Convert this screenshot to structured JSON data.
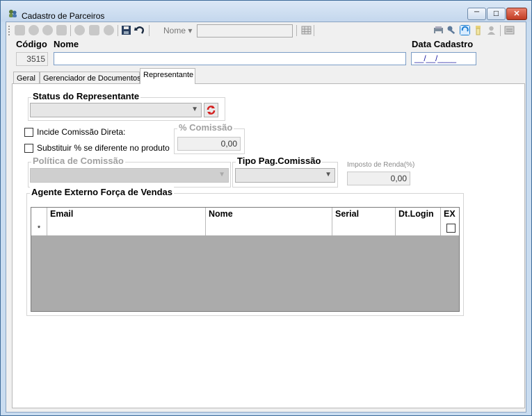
{
  "window": {
    "title": "Cadastro de Parceiros",
    "minimize": "─",
    "maximize": "□",
    "close": "✕"
  },
  "toolbar": {
    "search_field_label": "Nome ▾",
    "search_value": ""
  },
  "header": {
    "codigo_label": "Código",
    "codigo_value": "3515",
    "nome_label": "Nome",
    "nome_value": "",
    "data_label": "Data Cadastro",
    "data_value": "__/__/____"
  },
  "tabs": [
    {
      "label": "Geral",
      "active": false
    },
    {
      "label": "Gerenciador de Documentos",
      "active": false
    },
    {
      "label": "Representante",
      "active": true
    }
  ],
  "representante": {
    "status_title": "Status do Representante",
    "status_value": "",
    "incide_label": "Incide Comissão Direta:",
    "incide_checked": false,
    "substituir_label": "Substituir % se diferente no produto",
    "substituir_checked": false,
    "comissao_title": "% Comissão",
    "comissao_value": "0,00",
    "politica_title": "Política de Comissão",
    "politica_value": "",
    "tipo_pag_title": "Tipo Pag.Comissão",
    "tipo_pag_value": "",
    "imposto_label": "Imposto de Renda(%)",
    "imposto_value": "0,00",
    "agente_title": "Agente Externo Força de Vendas"
  },
  "grid": {
    "columns": [
      "Email",
      "Nome",
      "Serial",
      "Dt.Login",
      "EX"
    ],
    "new_row_marker": "*"
  },
  "colors": {
    "accent": "#1e7fd1",
    "frame": "#c9dcf0"
  }
}
